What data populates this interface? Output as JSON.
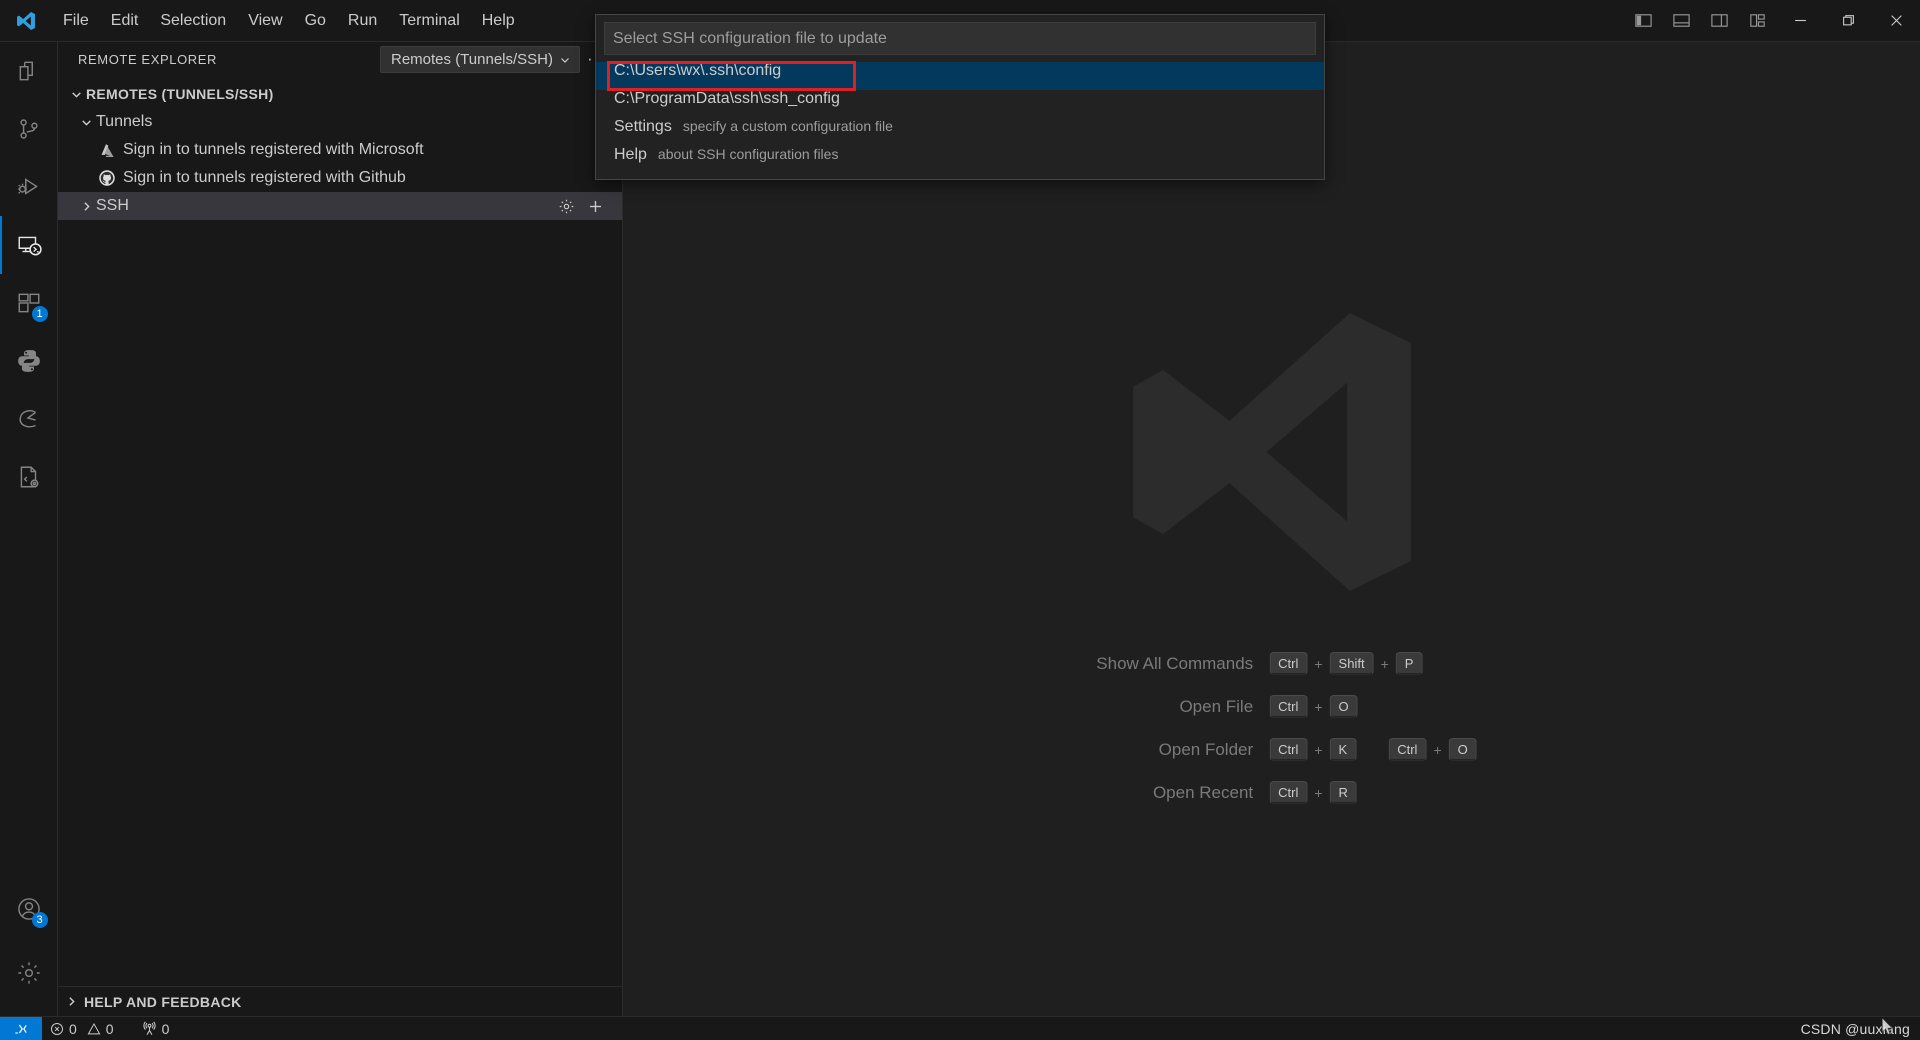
{
  "app": {
    "logo": "vscode-logo",
    "title": "Visual Studio Code"
  },
  "menubar": {
    "items": [
      {
        "label": "File"
      },
      {
        "label": "Edit"
      },
      {
        "label": "Selection"
      },
      {
        "label": "View"
      },
      {
        "label": "Go"
      },
      {
        "label": "Run"
      },
      {
        "label": "Terminal"
      },
      {
        "label": "Help"
      }
    ]
  },
  "titlebar_controls": {
    "layout_buttons": [
      {
        "name": "toggle-primary-sidebar-icon"
      },
      {
        "name": "toggle-panel-icon"
      },
      {
        "name": "toggle-secondary-sidebar-icon"
      },
      {
        "name": "customize-layout-icon"
      }
    ],
    "window_buttons": [
      {
        "name": "minimize-icon",
        "glyph": "—"
      },
      {
        "name": "maximize-restore-icon",
        "glyph": "❐"
      },
      {
        "name": "close-icon",
        "glyph": "✕"
      }
    ]
  },
  "activitybar": {
    "items": [
      {
        "name": "explorer-icon",
        "label": "Explorer",
        "active": false,
        "badge": ""
      },
      {
        "name": "source-control-icon",
        "label": "Source Control",
        "active": false,
        "badge": ""
      },
      {
        "name": "run-and-debug-icon",
        "label": "Run and Debug",
        "active": false,
        "badge": ""
      },
      {
        "name": "remote-explorer-icon",
        "label": "Remote Explorer",
        "active": true,
        "badge": ""
      },
      {
        "name": "extensions-icon",
        "label": "Extensions",
        "active": false,
        "badge": "1"
      },
      {
        "name": "python-icon",
        "label": "Python",
        "active": false,
        "badge": ""
      },
      {
        "name": "anaconda-icon",
        "label": "Anaconda",
        "active": false,
        "badge": ""
      },
      {
        "name": "testing-config-icon",
        "label": "Testing",
        "active": false,
        "badge": ""
      }
    ],
    "bottom_items": [
      {
        "name": "accounts-icon",
        "label": "Accounts",
        "badge": "3"
      },
      {
        "name": "manage-settings-gear-icon",
        "label": "Manage",
        "badge": ""
      }
    ]
  },
  "sidebar": {
    "title": "REMOTE EXPLORER",
    "views_dropdown": {
      "value": "Remotes (Tunnels/SSH)",
      "chevron": "chevron-down-icon"
    },
    "more_actions": "···",
    "tree": [
      {
        "name": "remotes-section",
        "label": "REMOTES (TUNNELS/SSH)",
        "twisty": "chevron-down",
        "indent": 0,
        "section": true,
        "icon": "",
        "selected": false
      },
      {
        "name": "tunnels-group",
        "label": "Tunnels",
        "twisty": "chevron-down",
        "indent": 1,
        "section": false,
        "icon": "",
        "selected": false
      },
      {
        "name": "sign-in-microsoft",
        "label": "Sign in to tunnels registered with Microsoft",
        "twisty": "",
        "indent": 2,
        "section": false,
        "icon": "azure-icon",
        "selected": false
      },
      {
        "name": "sign-in-github",
        "label": "Sign in to tunnels registered with Github",
        "twisty": "",
        "indent": 2,
        "section": false,
        "icon": "github-icon",
        "selected": false
      },
      {
        "name": "ssh-group",
        "label": "SSH",
        "twisty": "chevron-right",
        "indent": 1,
        "section": false,
        "icon": "",
        "selected": true,
        "actions": [
          "gear-icon",
          "plus-icon"
        ]
      }
    ],
    "footer": {
      "label": "HELP AND FEEDBACK",
      "twisty": "chevron-right"
    }
  },
  "quickpick": {
    "placeholder": "Select SSH configuration file to update",
    "value": "",
    "items": [
      {
        "label": "C:\\Users\\wx\\.ssh\\config",
        "description": "",
        "active": true,
        "highlighted": true
      },
      {
        "label": "C:\\ProgramData\\ssh\\ssh_config",
        "description": "",
        "active": false,
        "highlighted": false
      },
      {
        "label": "Settings",
        "description": "specify a custom configuration file",
        "active": false,
        "highlighted": false
      },
      {
        "label": "Help",
        "description": "about SSH configuration files",
        "active": false,
        "highlighted": false
      }
    ],
    "highlight_color": "#e02020",
    "active_color": "#04395e"
  },
  "watermark": {
    "rows": [
      {
        "label": "Show All Commands",
        "keys": [
          [
            "Ctrl",
            "Shift",
            "P"
          ]
        ]
      },
      {
        "label": "Open File",
        "keys": [
          [
            "Ctrl",
            "O"
          ]
        ]
      },
      {
        "label": "Open Folder",
        "keys": [
          [
            "Ctrl",
            "K"
          ],
          [
            "Ctrl",
            "O"
          ]
        ]
      },
      {
        "label": "Open Recent",
        "keys": [
          [
            "Ctrl",
            "R"
          ]
        ]
      }
    ]
  },
  "statusbar": {
    "remote_indicator": "remote-host-icon",
    "problems": {
      "error_icon": "error-circle-icon",
      "errors": "0",
      "warning_icon": "warning-triangle-icon",
      "warnings": "0"
    },
    "ports": {
      "icon": "radio-tower-icon",
      "count": "0"
    },
    "watermark_text": "CSDN @uuxiang"
  },
  "colors": {
    "accent": "#0078d4",
    "titlebar_bg": "#181818",
    "editor_bg": "#1f1f1f",
    "sidebar_bg": "#181818",
    "selection_bg": "#37373d",
    "quickpick_bg": "#222222",
    "highlight_red": "#e02020"
  }
}
